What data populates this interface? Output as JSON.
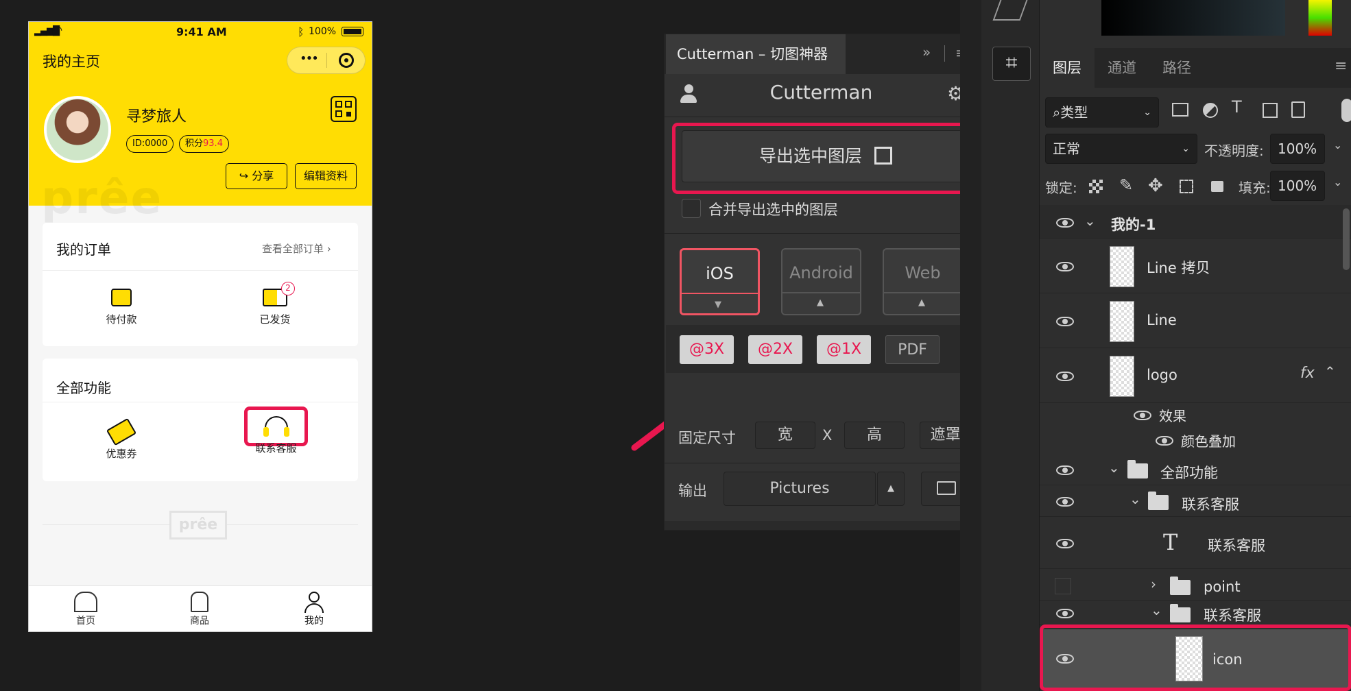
{
  "phone": {
    "status": {
      "time": "9:41 AM",
      "battery": "100%"
    },
    "nav_title": "我的主页",
    "capsule": {
      "more": "•••"
    },
    "user": {
      "name": "寻梦旅人",
      "id": "ID:0000",
      "points_label": "积分",
      "points_value": "93.4"
    },
    "actions": {
      "share": "分享",
      "edit": "编辑资料"
    },
    "watermark": "prêe",
    "orders": {
      "title": "我的订单",
      "view_all": "查看全部订单 ›",
      "items": [
        {
          "label": "待付款"
        },
        {
          "label": "已发货",
          "badge": "2"
        }
      ]
    },
    "functions": {
      "title": "全部功能",
      "items": [
        {
          "label": "优惠券"
        },
        {
          "label": "联系客服"
        }
      ]
    },
    "footer_logo": "prêe",
    "tabbar": [
      {
        "label": "首页"
      },
      {
        "label": "商品"
      },
      {
        "label": "我的"
      }
    ]
  },
  "cutterman": {
    "tab_title": "Cutterman – 切图神器",
    "panel_title": "Cutterman",
    "export_button": "导出选中图层",
    "merge_checkbox": "合并导出选中的图层",
    "platforms": [
      "iOS",
      "Android",
      "Web"
    ],
    "selected_platform": "iOS",
    "scales": [
      "@3X",
      "@2X",
      "@1X",
      "PDF"
    ],
    "fixed_size": {
      "label": "固定尺寸",
      "width": "宽",
      "x": "X",
      "height": "高",
      "mask": "遮罩"
    },
    "output": {
      "label": "输出",
      "folder": "Pictures"
    }
  },
  "layers_panel": {
    "tabs": [
      "图层",
      "通道",
      "路径"
    ],
    "filter_kind": "类型",
    "blend_mode": "正常",
    "opacity_label": "不透明度:",
    "opacity_value": "100%",
    "lock_label": "锁定:",
    "fill_label": "填充:",
    "fill_value": "100%",
    "fx": "fx",
    "layers": [
      {
        "name": "我的-1"
      },
      {
        "name": "Line 拷贝"
      },
      {
        "name": "Line"
      },
      {
        "name": "logo"
      },
      {
        "name": "效果"
      },
      {
        "name": "颜色叠加"
      },
      {
        "name": "全部功能"
      },
      {
        "name": "联系客服"
      },
      {
        "name": "联系客服"
      },
      {
        "name": "point"
      },
      {
        "name": "联系客服"
      },
      {
        "name": "icon"
      }
    ]
  },
  "colors": {
    "brand_yellow": "#ffdd03",
    "highlight": "#e8174f"
  }
}
